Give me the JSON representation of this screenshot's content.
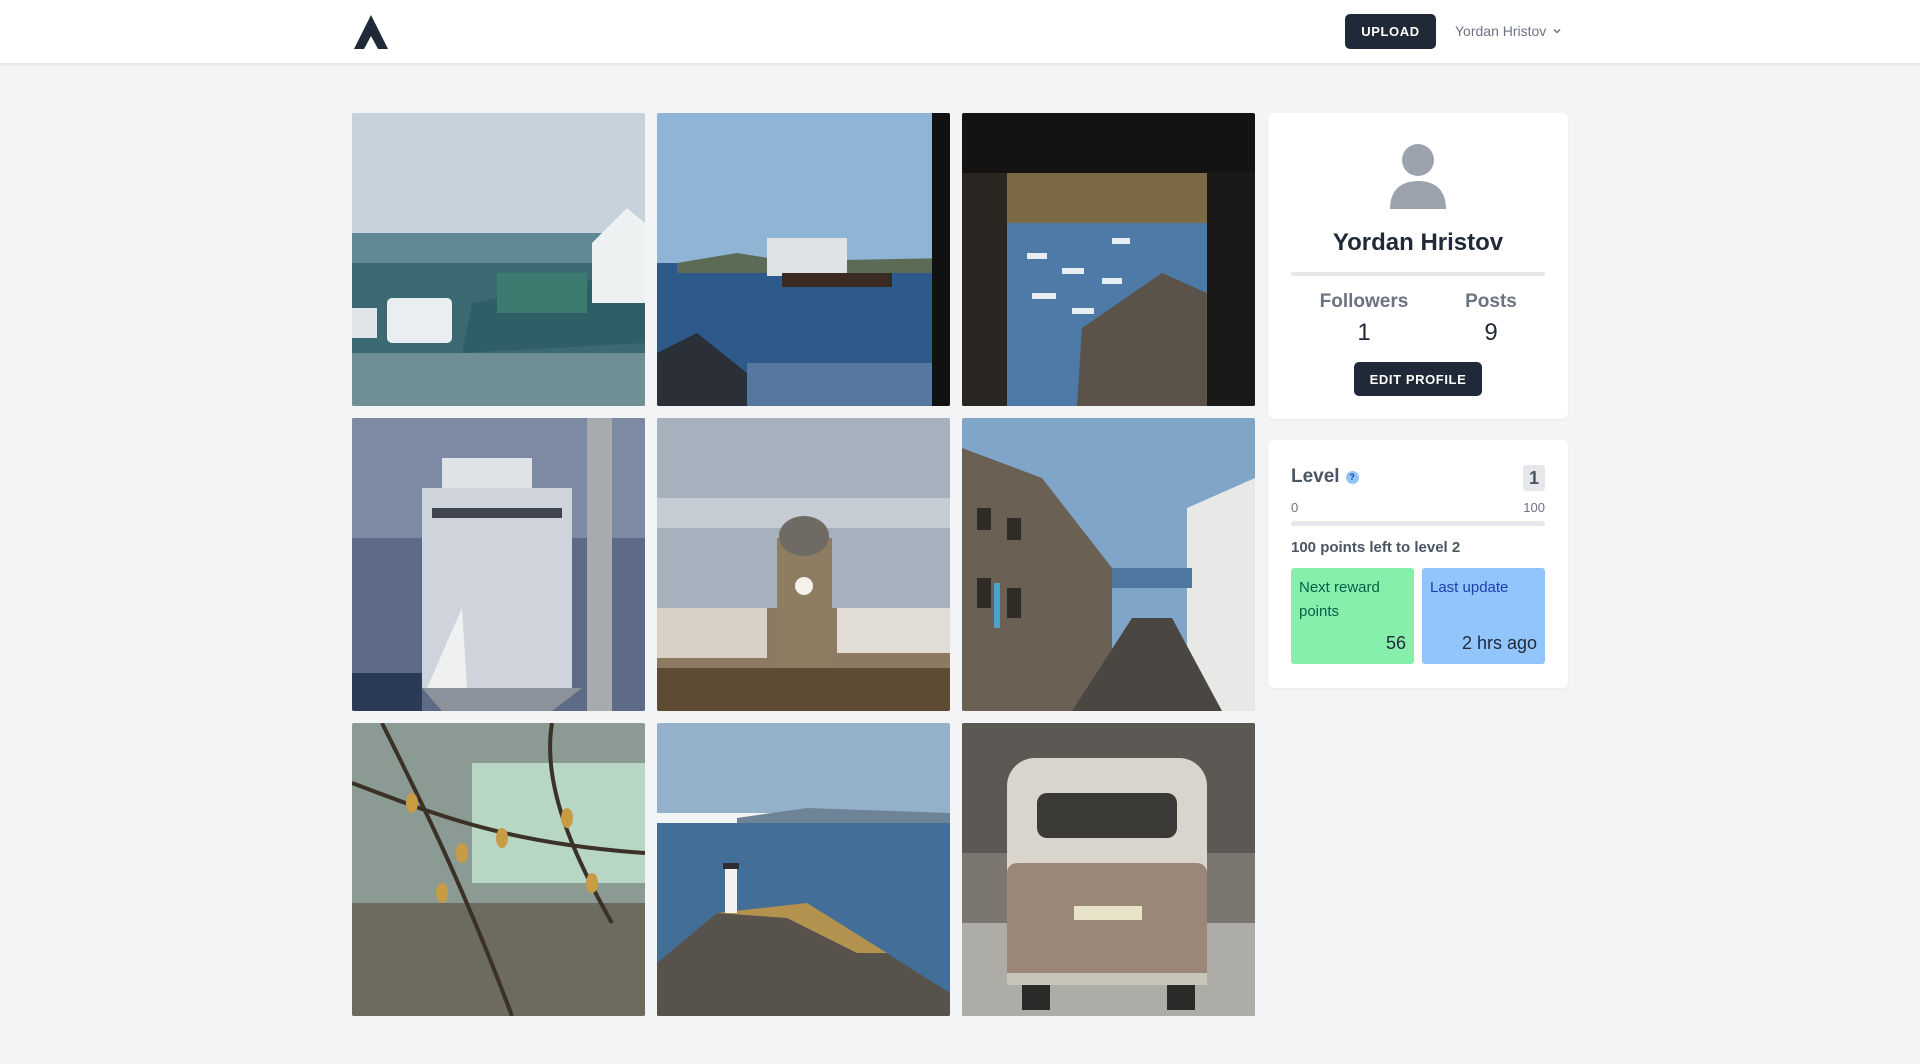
{
  "header": {
    "upload_label": "UPLOAD",
    "user_name": "Yordan Hristov"
  },
  "photos": [
    {
      "alt": "street-with-van-and-harbor",
      "palette": [
        "#9fb8c4",
        "#2f6b78"
      ]
    },
    {
      "alt": "ship-in-harbor",
      "palette": [
        "#8fb2d2",
        "#254f7b"
      ]
    },
    {
      "alt": "boats-through-window",
      "palette": [
        "#161514",
        "#4e7aa4"
      ]
    },
    {
      "alt": "white-ship-docked",
      "palette": [
        "#5d6d8a",
        "#c7ccd6"
      ]
    },
    {
      "alt": "clock-tower",
      "palette": [
        "#9aa6b5",
        "#7a6448"
      ]
    },
    {
      "alt": "terraced-street",
      "palette": [
        "#7fa4c8",
        "#5d5448"
      ]
    },
    {
      "alt": "budding-branches",
      "palette": [
        "#8fa6a0",
        "#6f5a3c"
      ]
    },
    {
      "alt": "lighthouse-breakwater",
      "palette": [
        "#9bb4cc",
        "#54524c"
      ]
    },
    {
      "alt": "vintage-van",
      "palette": [
        "#8c8a84",
        "#4a4743"
      ]
    }
  ],
  "profile": {
    "name": "Yordan Hristov",
    "followers_label": "Followers",
    "followers_count": "1",
    "posts_label": "Posts",
    "posts_count": "9",
    "edit_label": "EDIT PROFILE"
  },
  "level": {
    "title": "Level",
    "help": "?",
    "value": "1",
    "range_min": "0",
    "range_max": "100",
    "progress_fraction": 0,
    "points_left_text": "100 points left to level 2",
    "reward": {
      "label": "Next reward points",
      "value": "56"
    },
    "update": {
      "label": "Last update",
      "value": "2 hrs ago"
    }
  },
  "colors": {
    "primary_button": "#1f2937",
    "reward_tile": "#86efac",
    "update_tile": "#93c5fd",
    "background": "#f3f4f6"
  }
}
